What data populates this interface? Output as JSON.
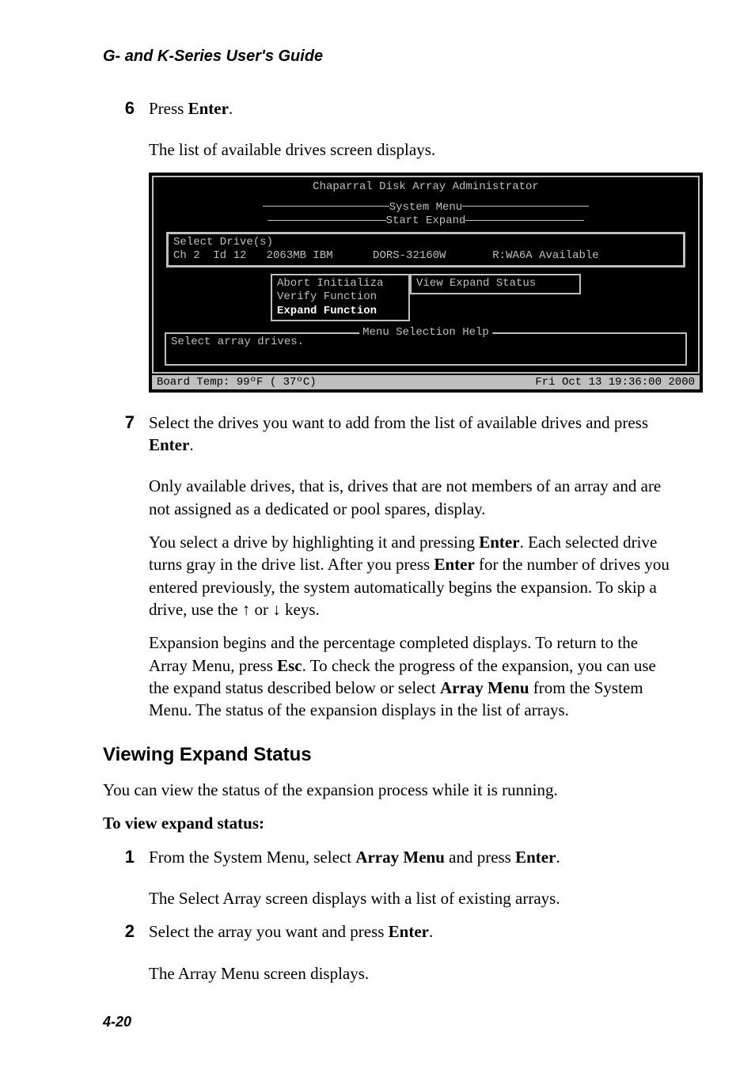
{
  "header": "G- and K-Series User's Guide",
  "step6": {
    "num": "6",
    "text_a": "Press ",
    "text_b": "Enter",
    "text_c": ".",
    "after": "The list of available drives screen displays."
  },
  "terminal": {
    "title": "Chaparral Disk Array Administrator",
    "sys_menu": "System Menu",
    "start_expand": "Start Expand",
    "select_drives": "Select Drive(s)",
    "drive_row": "Ch 2  Id 12   2063MB IBM      DORS-32160W       R:WA6A Available",
    "box_line1": "Abort Initializa",
    "box_side": "View Expand Status",
    "box_line2": "Verify Function",
    "box_line3": "Expand Function",
    "help_label": "Menu Selection Help",
    "help_text": "Select array drives.",
    "status_left": "Board Temp:  99ºF ( 37ºC)",
    "status_right": "Fri Oct 13 19:36:00 2000"
  },
  "step7": {
    "num": "7",
    "p1_a": "Select the drives you want to add from the list of available drives and press ",
    "p1_b": "Enter",
    "p1_c": ".",
    "p2": "Only available drives, that is, drives that are not members of an array and are not assigned as a dedicated or pool spares, display.",
    "p3_a": "You select a drive by highlighting it and pressing ",
    "p3_b": "Enter",
    "p3_c": ". Each selected drive turns gray in the drive list. After you press ",
    "p3_d": "Enter",
    "p3_e": " for the number of drives you entered previously, the system automatically begins the expansion. To skip a drive, use the ↑ or ↓ keys.",
    "p4_a": "Expansion begins and the percentage completed displays. To return to the Array Menu, press ",
    "p4_b": "Esc",
    "p4_c": ". To check the progress of the expansion, you can use the expand status described below or select ",
    "p4_d": "Array Menu",
    "p4_e": " from the System Menu. The status of the expansion displays in the list of arrays."
  },
  "section": "Viewing Expand Status",
  "view_intro": "You can view the status of the expansion process while it is running.",
  "view_heading": "To view expand status:",
  "vstep1": {
    "num": "1",
    "a": "From the System Menu, select ",
    "b": "Array Menu",
    "c": " and press ",
    "d": "Enter",
    "e": ".",
    "after": "The Select Array screen displays with a list of existing arrays."
  },
  "vstep2": {
    "num": "2",
    "a": "Select the array you want and press ",
    "b": "Enter",
    "c": ".",
    "after": "The Array Menu screen displays."
  },
  "footer": "4-20"
}
